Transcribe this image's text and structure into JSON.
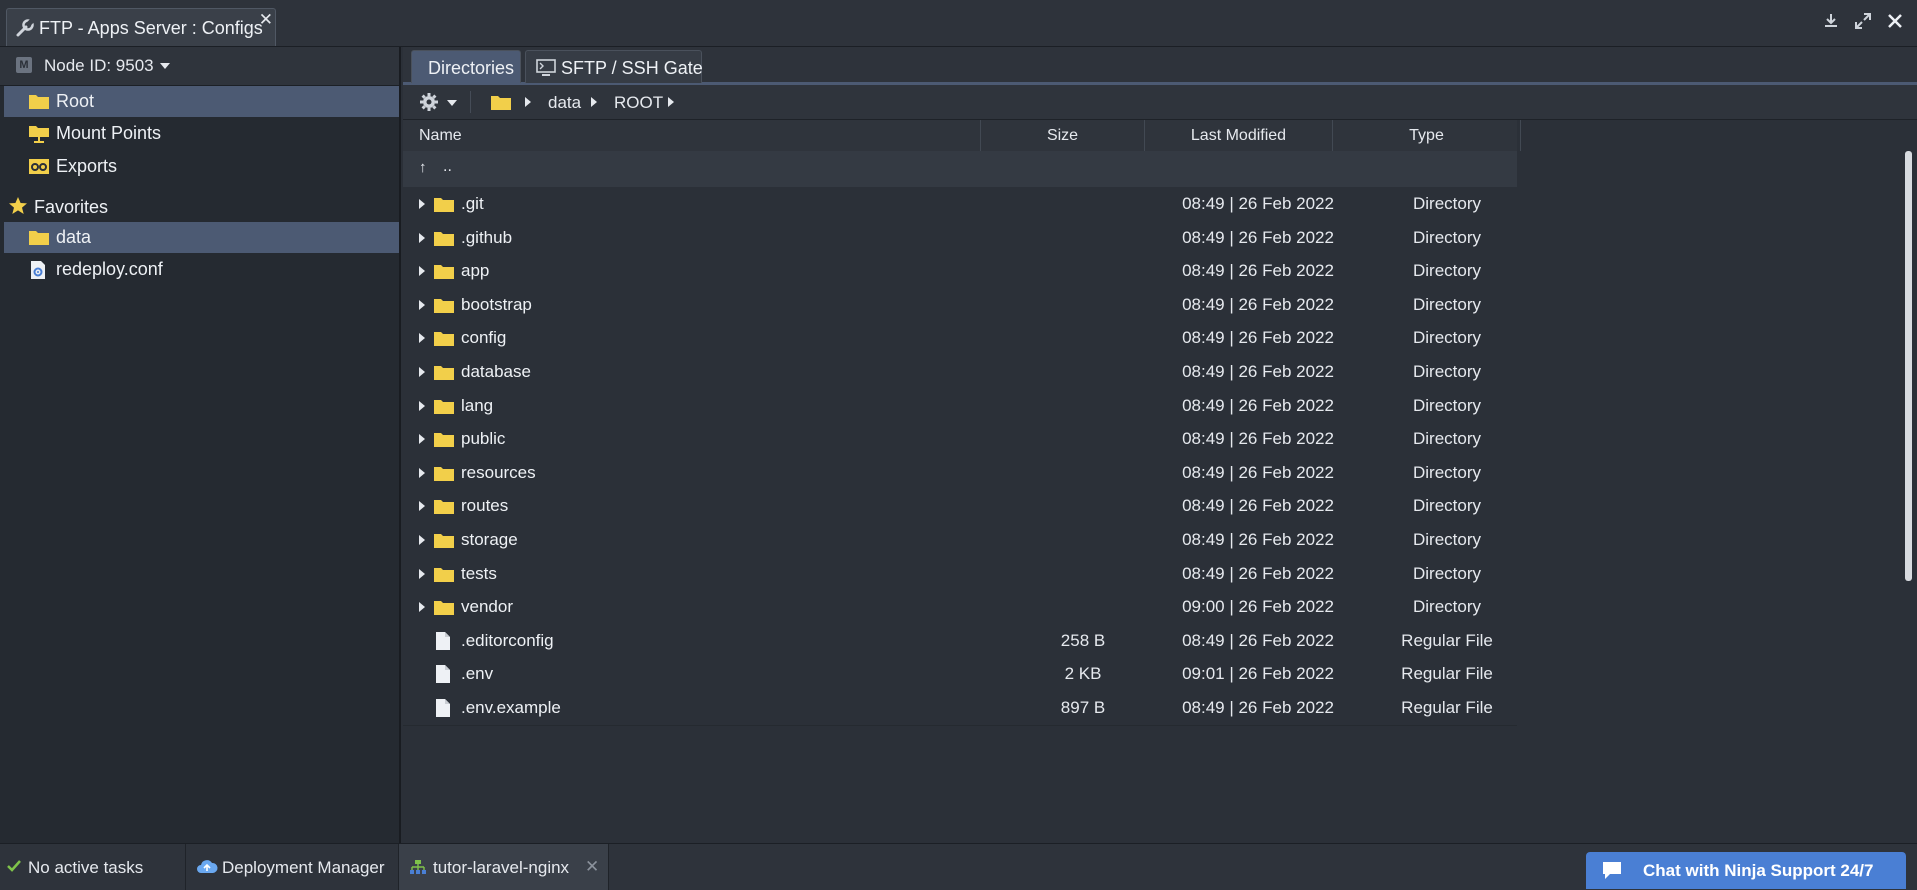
{
  "window": {
    "title": "FTP - Apps Server : Configs",
    "close_glyph": "✕"
  },
  "sidebar": {
    "node_label": "Node ID: 9503",
    "node_badge": "M",
    "items": [
      {
        "label": "Root",
        "icon": "folder-icon",
        "selected": true
      },
      {
        "label": "Mount Points",
        "icon": "mount-points-icon",
        "selected": false
      },
      {
        "label": "Exports",
        "icon": "exports-icon",
        "selected": false
      }
    ],
    "favorites_label": "Favorites",
    "favorites": [
      {
        "label": "data",
        "icon": "folder-icon",
        "selected": true
      },
      {
        "label": "redeploy.conf",
        "icon": "config-file-icon",
        "selected": false
      }
    ]
  },
  "main": {
    "tabs": [
      {
        "label": "Directories",
        "active": true
      },
      {
        "label": "SFTP / SSH Gate",
        "active": false
      }
    ],
    "breadcrumb": [
      "data",
      "ROOT"
    ],
    "columns": {
      "name": "Name",
      "size": "Size",
      "modified": "Last Modified",
      "type": "Type"
    },
    "parent_row": {
      "arrow": "↑",
      "label": ".."
    },
    "rows": [
      {
        "name": ".git",
        "size": "",
        "modified": "08:49 | 26 Feb 2022",
        "type": "Directory",
        "kind": "dir"
      },
      {
        "name": ".github",
        "size": "",
        "modified": "08:49 | 26 Feb 2022",
        "type": "Directory",
        "kind": "dir"
      },
      {
        "name": "app",
        "size": "",
        "modified": "08:49 | 26 Feb 2022",
        "type": "Directory",
        "kind": "dir"
      },
      {
        "name": "bootstrap",
        "size": "",
        "modified": "08:49 | 26 Feb 2022",
        "type": "Directory",
        "kind": "dir"
      },
      {
        "name": "config",
        "size": "",
        "modified": "08:49 | 26 Feb 2022",
        "type": "Directory",
        "kind": "dir"
      },
      {
        "name": "database",
        "size": "",
        "modified": "08:49 | 26 Feb 2022",
        "type": "Directory",
        "kind": "dir"
      },
      {
        "name": "lang",
        "size": "",
        "modified": "08:49 | 26 Feb 2022",
        "type": "Directory",
        "kind": "dir"
      },
      {
        "name": "public",
        "size": "",
        "modified": "08:49 | 26 Feb 2022",
        "type": "Directory",
        "kind": "dir"
      },
      {
        "name": "resources",
        "size": "",
        "modified": "08:49 | 26 Feb 2022",
        "type": "Directory",
        "kind": "dir"
      },
      {
        "name": "routes",
        "size": "",
        "modified": "08:49 | 26 Feb 2022",
        "type": "Directory",
        "kind": "dir"
      },
      {
        "name": "storage",
        "size": "",
        "modified": "08:49 | 26 Feb 2022",
        "type": "Directory",
        "kind": "dir"
      },
      {
        "name": "tests",
        "size": "",
        "modified": "08:49 | 26 Feb 2022",
        "type": "Directory",
        "kind": "dir"
      },
      {
        "name": "vendor",
        "size": "",
        "modified": "09:00 | 26 Feb 2022",
        "type": "Directory",
        "kind": "dir"
      },
      {
        "name": ".editorconfig",
        "size": "258 B",
        "modified": "08:49 | 26 Feb 2022",
        "type": "Regular File",
        "kind": "file"
      },
      {
        "name": ".env",
        "size": "2 KB",
        "modified": "09:01 | 26 Feb 2022",
        "type": "Regular File",
        "kind": "file"
      },
      {
        "name": ".env.example",
        "size": "897 B",
        "modified": "08:49 | 26 Feb 2022",
        "type": "Regular File",
        "kind": "file"
      }
    ]
  },
  "taskbar": {
    "status": "No active tasks",
    "deployment_manager": "Deployment Manager",
    "active_env": "tutor-laravel-nginx",
    "close_glyph": "✕",
    "chat": "Chat with Ninja Support 24/7"
  },
  "colors": {
    "background": "#2b3038",
    "selection": "#4c5a73",
    "folder": "#f2cf4a",
    "chat_button": "#4a7fd4",
    "status_ok": "#7fc34a"
  }
}
